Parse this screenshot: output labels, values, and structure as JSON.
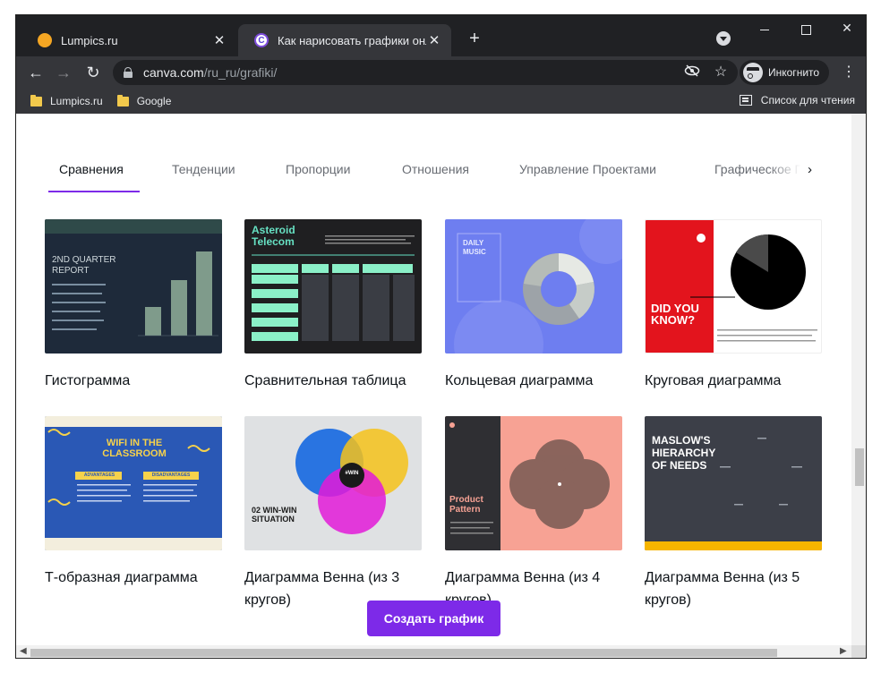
{
  "browser": {
    "tabs": [
      {
        "title": "Lumpics.ru",
        "icon": "orange-circle-favicon"
      },
      {
        "title": "Как нарисовать графики онлай",
        "icon": "canva-favicon",
        "active": true
      }
    ],
    "close_glyph": "✕",
    "new_tab_glyph": "+",
    "url_host": "canva.com",
    "url_path": "/ru_ru/grafiki/",
    "incognito_label": "Инкогнито",
    "bookmarks": [
      "Lumpics.ru",
      "Google"
    ],
    "reading_list_label": "Список для чтения"
  },
  "page": {
    "category_tabs": [
      "Сравнения",
      "Тенденции",
      "Пропорции",
      "Отношения",
      "Управление Проектами",
      "Графическое П"
    ],
    "selected_tab": "Сравнения",
    "accent_color": "#7d2ae8",
    "templates": [
      {
        "label": "Гистограмма",
        "thumb": {
          "title": "2ND QUARTER REPORT"
        }
      },
      {
        "label": "Сравнительная таблица",
        "thumb": {
          "title": "Asteroid Telecom"
        }
      },
      {
        "label": "Кольцевая диаграмма",
        "thumb": {
          "title": "DAILY MUSIC"
        }
      },
      {
        "label": "Круговая диаграмма",
        "thumb": {
          "title": "DID YOU KNOW?"
        }
      },
      {
        "label": "Т-образная диаграмма",
        "thumb": {
          "title": "WIFI IN THE CLASSROOM",
          "left_tag": "ADVANTAGES",
          "right_tag": "DISADVANTAGES"
        }
      },
      {
        "label": "Диаграмма Венна (из 3 кругов)",
        "thumb": {
          "title": "02 WIN-WIN SITUATION",
          "center": "#WIN"
        }
      },
      {
        "label": "Диаграмма Венна (из 4 кругов)",
        "thumb": {
          "title": "Product Pattern"
        }
      },
      {
        "label": "Диаграмма Венна (из 5 кругов)",
        "thumb": {
          "title": "MASLOW'S HIERARCHY OF NEEDS"
        }
      }
    ],
    "create_button": "Создать график"
  }
}
